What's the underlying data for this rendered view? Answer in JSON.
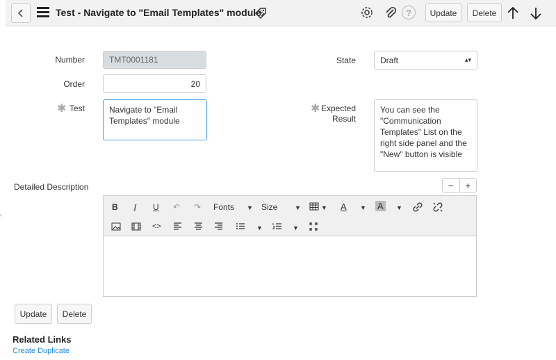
{
  "header": {
    "title": "Test - Navigate to \"Email Templates\" module",
    "update_label": "Update",
    "delete_label": "Delete",
    "help_glyph": "?"
  },
  "form": {
    "number_label": "Number",
    "number_value": "TMT0001181",
    "order_label": "Order",
    "order_value": "20",
    "test_label": "Test",
    "test_value": "Navigate to \"Email Templates\" module",
    "state_label": "State",
    "state_value": "Draft",
    "expected_label_1": "Expected",
    "expected_label_2": "Result",
    "expected_value": "You can see the \"Communication Templates\" List on the right side panel and the \"New\" button is visible",
    "detailed_label": "Detailed Description"
  },
  "editor": {
    "bold": "B",
    "italic": "I",
    "underline": "U",
    "fonts_label": "Fonts",
    "size_label": "Size",
    "font_color_glyph": "A",
    "bg_color_glyph": "A",
    "code_glyph": "<>",
    "minus": "−",
    "plus": "+"
  },
  "footer": {
    "update_label": "Update",
    "delete_label": "Delete",
    "related_title": "Related Links",
    "create_duplicate": "Create Duplicate"
  }
}
